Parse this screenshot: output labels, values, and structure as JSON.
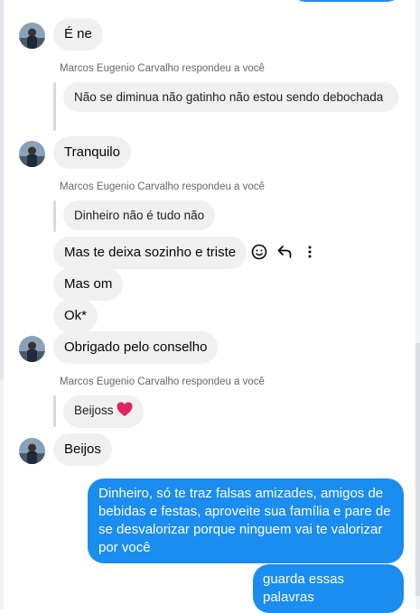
{
  "thread": {
    "contact_name": "Marcos Eugenio Carvalho",
    "reply_label": "Marcos Eugenio Carvalho respondeu a você"
  },
  "messages": {
    "m1": "É ne",
    "q1": "Não se diminua não gatinho não estou sendo debochada",
    "m2": "Tranquilo",
    "q2": "Dinheiro não é tudo não",
    "m3": "Mas te deixa sozinho e triste",
    "m4": "Mas om",
    "m5": "Ok*",
    "m6": "Obrigado pelo conselho",
    "q3": "Beijoss",
    "m7": "Beijos",
    "out1": "Dinheiro, só te traz falsas amizades, amigos de bebidas e festas, aproveite sua família e pare de se desvalorizar porque ninguem vai te valorizar por você",
    "out2": "guarda essas palavras"
  },
  "icons": {
    "react": "smiley-icon",
    "reply": "reply-arrow-icon",
    "more": "more-vertical-icon",
    "heart": "red-heart-icon"
  },
  "colors": {
    "outgoing_bubble": "#1b8cf0",
    "incoming_bubble": "#f0f0f0",
    "reply_label": "#65676b",
    "heart": "#e0245e"
  }
}
